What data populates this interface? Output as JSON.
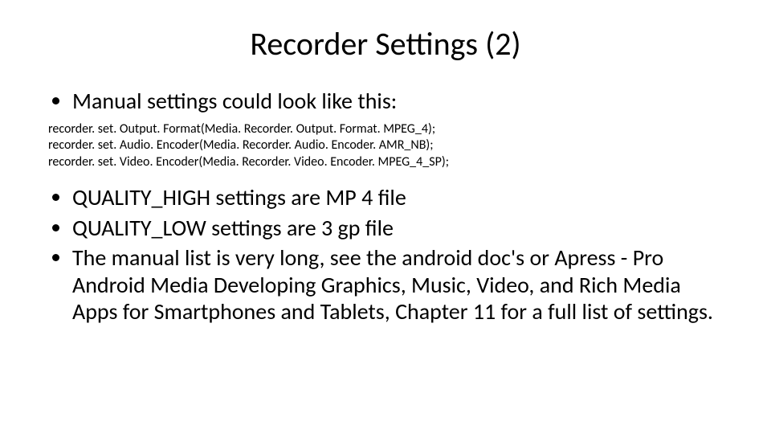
{
  "title": "Recorder Settings (2)",
  "bullet1": "Manual settings could look like this:",
  "code": {
    "line1": "recorder. set. Output. Format(Media. Recorder. Output. Format. MPEG_4);",
    "line2": "recorder. set. Audio. Encoder(Media. Recorder. Audio. Encoder. AMR_NB);",
    "line3": "recorder. set. Video. Encoder(Media. Recorder. Video. Encoder. MPEG_4_SP);"
  },
  "bullet2": "QUALITY_HIGH settings are MP 4 file",
  "bullet3": "QUALITY_LOW settings are 3 gp file",
  "bullet4": "The manual list is very long, see the android doc's or Apress - Pro Android Media Developing Graphics, Music, Video, and Rich Media Apps for Smartphones and Tablets,  Chapter 11 for a full list of settings."
}
